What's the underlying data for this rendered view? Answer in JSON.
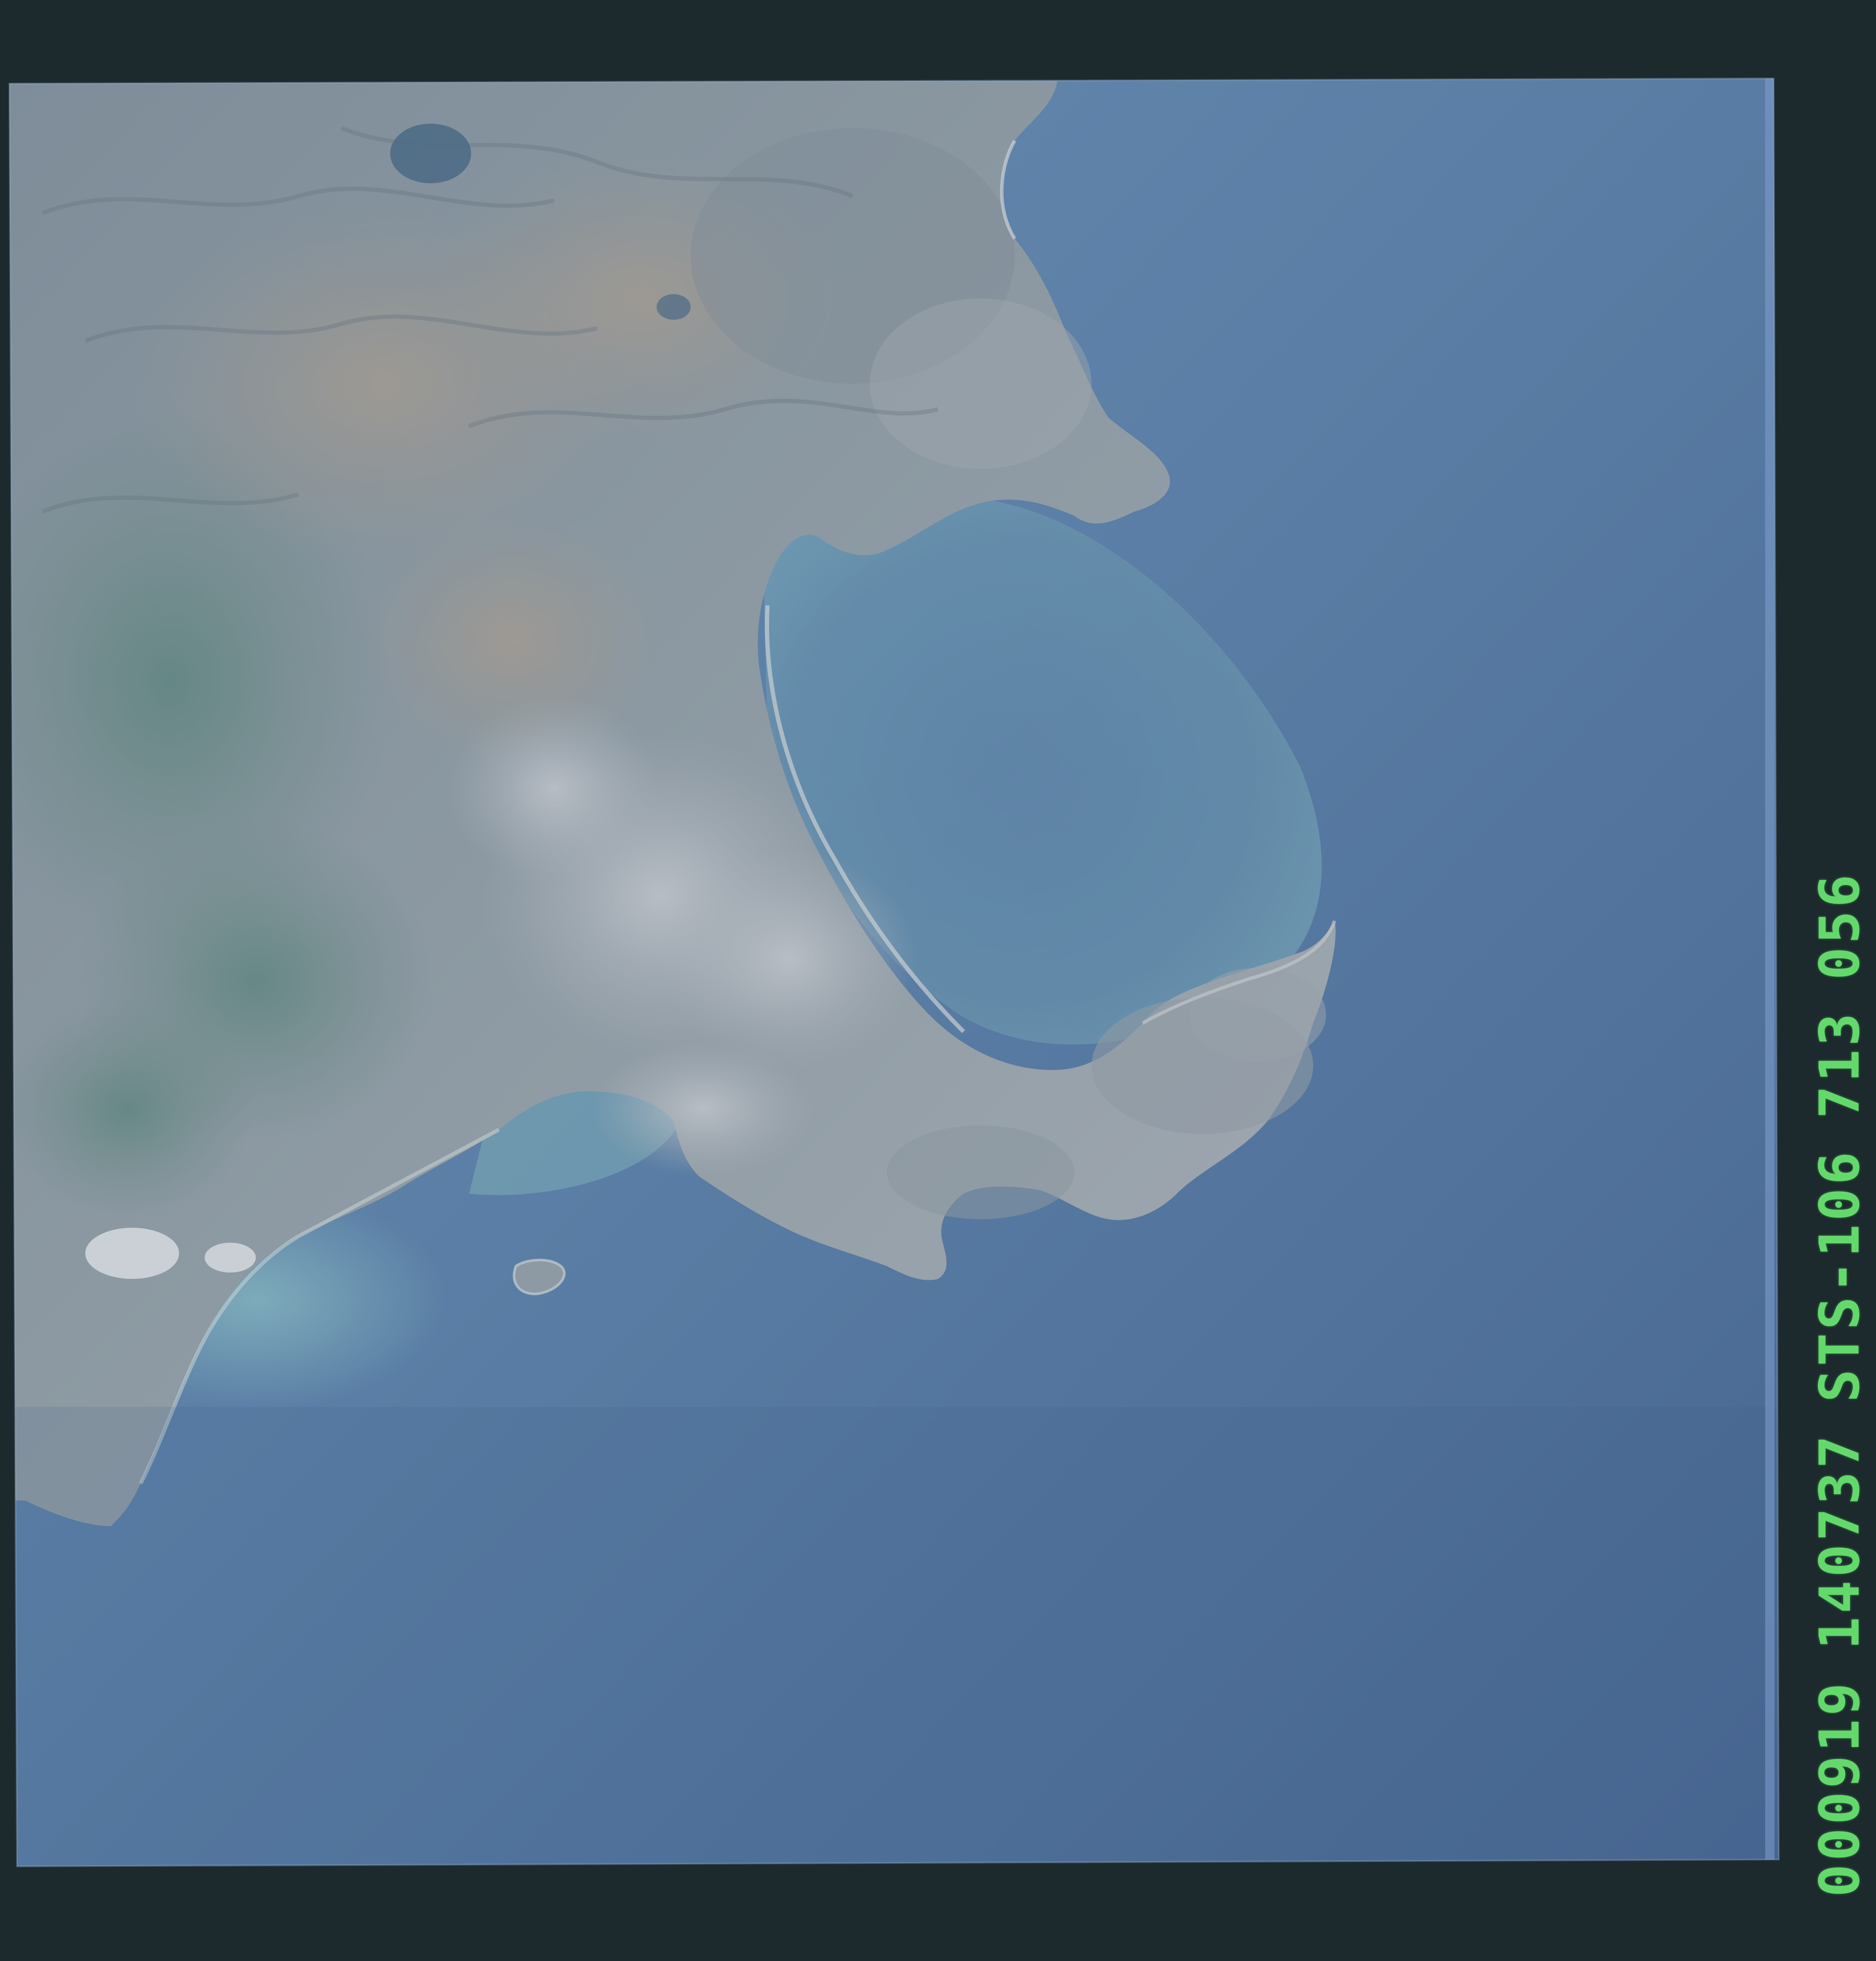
{
  "photo": {
    "subject": "orbital-earth-photograph",
    "colors": {
      "film_border": "#1d2a2d",
      "ocean_deep": "#4a6b95",
      "ocean_mid": "#5a7ea5",
      "ocean_shallow": "#6f9bb0",
      "bay_turquoise": "#79a9b8",
      "land_grey": "#8a9aa6",
      "land_green": "#6d8a86",
      "land_tan": "#9a9690",
      "urban": "#b4b9c2",
      "film_edge_blue": "#7f9ed0"
    }
  },
  "data_strip": {
    "date_code": "000919",
    "time_code": "140737",
    "mission": "STS-106",
    "roll": "713",
    "frame": "056",
    "text_color": "#63d96b"
  }
}
